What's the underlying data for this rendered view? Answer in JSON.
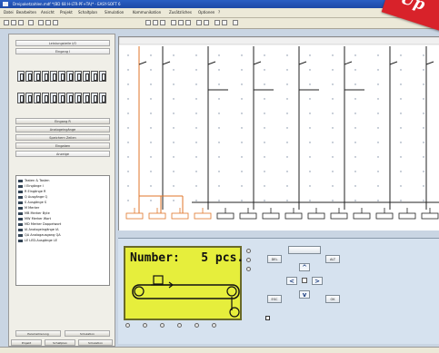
{
  "window": {
    "title": "Dreipaketzahlen.mdf *(BD 68 H-LTR-PF+TA)* - EASY-SOFT 6"
  },
  "menubar": {
    "items": [
      "Datei",
      "Bearbeiten",
      "Ansicht",
      "Projekt",
      "Schaltplan",
      "Simulation",
      "Kommunikation",
      "Zusätzliches",
      "Optionen",
      "?"
    ]
  },
  "sidebar": {
    "tabs": [
      "Leistungsteile I/O",
      "Eingang I",
      "Eingang R",
      "Analogeingänge",
      "Speichern Zeilen",
      "Eingaben",
      "Anzeige"
    ],
    "tree_items": [
      "Tasten & Tasten",
      "I  Eingänge I",
      "R  Eingänge R",
      "Q  Ausgänge Q",
      "S  Ausgänge S",
      "M  Merker",
      "MB  Merker Byte",
      "MW  Merker Wort",
      "MD  Merker Doppelwort",
      "IA  Analogeingänge IA",
      "QA  Analogausgang QA",
      "LE  LED-Ausgänge LE"
    ],
    "footer": [
      "Parametrierung",
      "Simulation",
      "Projekt",
      "Schaltplan",
      "Simulation"
    ]
  },
  "simulation": {
    "display_text": "Number:   5 pcs.",
    "esc_label": "ESC",
    "alt_label": "ALT",
    "del_label": "DEL",
    "ok_label": "OK",
    "arrow_up": "^",
    "arrow_down": "v",
    "arrow_left": "<",
    "arrow_right": ">"
  },
  "badge": {
    "text": "Up"
  },
  "colors": {
    "lcd_background": "#e6ee3c",
    "badge_red": "#d8222a",
    "rung_highlight": "#e0762a"
  }
}
